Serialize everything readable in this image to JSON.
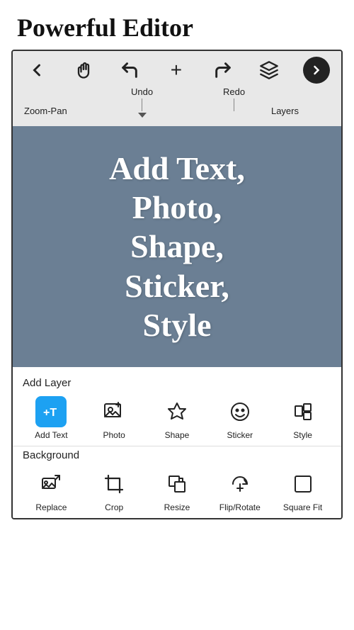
{
  "header": {
    "title": "Powerful Editor"
  },
  "toolbar": {
    "icons": [
      {
        "name": "back-arrow",
        "symbol": "←",
        "label": ""
      },
      {
        "name": "hand-zoom",
        "symbol": "☜",
        "label": ""
      },
      {
        "name": "undo-icon",
        "symbol": "↺",
        "label": ""
      },
      {
        "name": "add-icon",
        "symbol": "+",
        "label": ""
      },
      {
        "name": "redo-icon",
        "symbol": "↻",
        "label": ""
      },
      {
        "name": "layers-icon",
        "symbol": "⧉",
        "label": ""
      },
      {
        "name": "next-button",
        "symbol": "→",
        "label": ""
      }
    ],
    "labels": {
      "zoom_pan": "Zoom-Pan",
      "undo": "Undo",
      "redo": "Redo",
      "layers": "Layers"
    }
  },
  "canvas": {
    "text": "Add Text,\nPhoto,\nShape,\nSticker,\nStyle"
  },
  "add_layer_section": {
    "title": "Add Layer",
    "tools": [
      {
        "name": "add-text",
        "label": "Add Text",
        "icon_type": "add-text"
      },
      {
        "name": "photo",
        "label": "Photo",
        "icon_type": "photo"
      },
      {
        "name": "shape",
        "label": "Shape",
        "icon_type": "shape"
      },
      {
        "name": "sticker",
        "label": "Sticker",
        "icon_type": "sticker"
      },
      {
        "name": "style",
        "label": "Style",
        "icon_type": "style"
      }
    ]
  },
  "background_section": {
    "title": "Background",
    "tools": [
      {
        "name": "replace",
        "label": "Replace",
        "icon_type": "replace"
      },
      {
        "name": "crop",
        "label": "Crop",
        "icon_type": "crop"
      },
      {
        "name": "resize",
        "label": "Resize",
        "icon_type": "resize"
      },
      {
        "name": "flip-rotate",
        "label": "Flip/Rotate",
        "icon_type": "flip-rotate"
      },
      {
        "name": "square-fit",
        "label": "Square Fit",
        "icon_type": "square-fit"
      }
    ]
  }
}
